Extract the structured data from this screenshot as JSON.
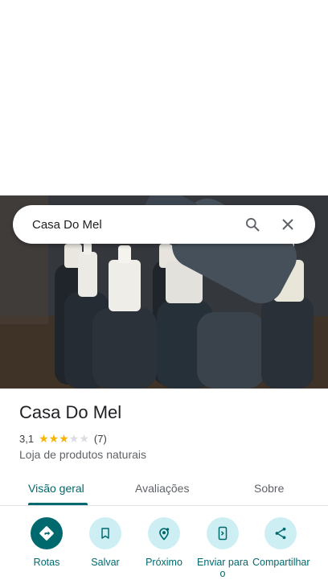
{
  "search": {
    "query": "Casa Do Mel"
  },
  "place": {
    "name": "Casa Do Mel",
    "rating": "3,1",
    "rating_value": 3.1,
    "reviews": "(7)",
    "category": "Loja de produtos naturais"
  },
  "tabs": [
    {
      "label": "Visão geral",
      "active": true
    },
    {
      "label": "Avaliações",
      "active": false
    },
    {
      "label": "Sobre",
      "active": false
    }
  ],
  "actions": [
    {
      "label": "Rotas",
      "icon": "directions-icon"
    },
    {
      "label": "Salvar",
      "icon": "bookmark-icon"
    },
    {
      "label": "Próximo",
      "icon": "nearby-icon"
    },
    {
      "label": "Enviar para o",
      "icon": "send-to-phone-icon"
    },
    {
      "label": "Compartilhar",
      "icon": "share-icon"
    }
  ],
  "colors": {
    "accent": "#00696e",
    "chip": "#cdeff4",
    "star": "#f4b400"
  }
}
